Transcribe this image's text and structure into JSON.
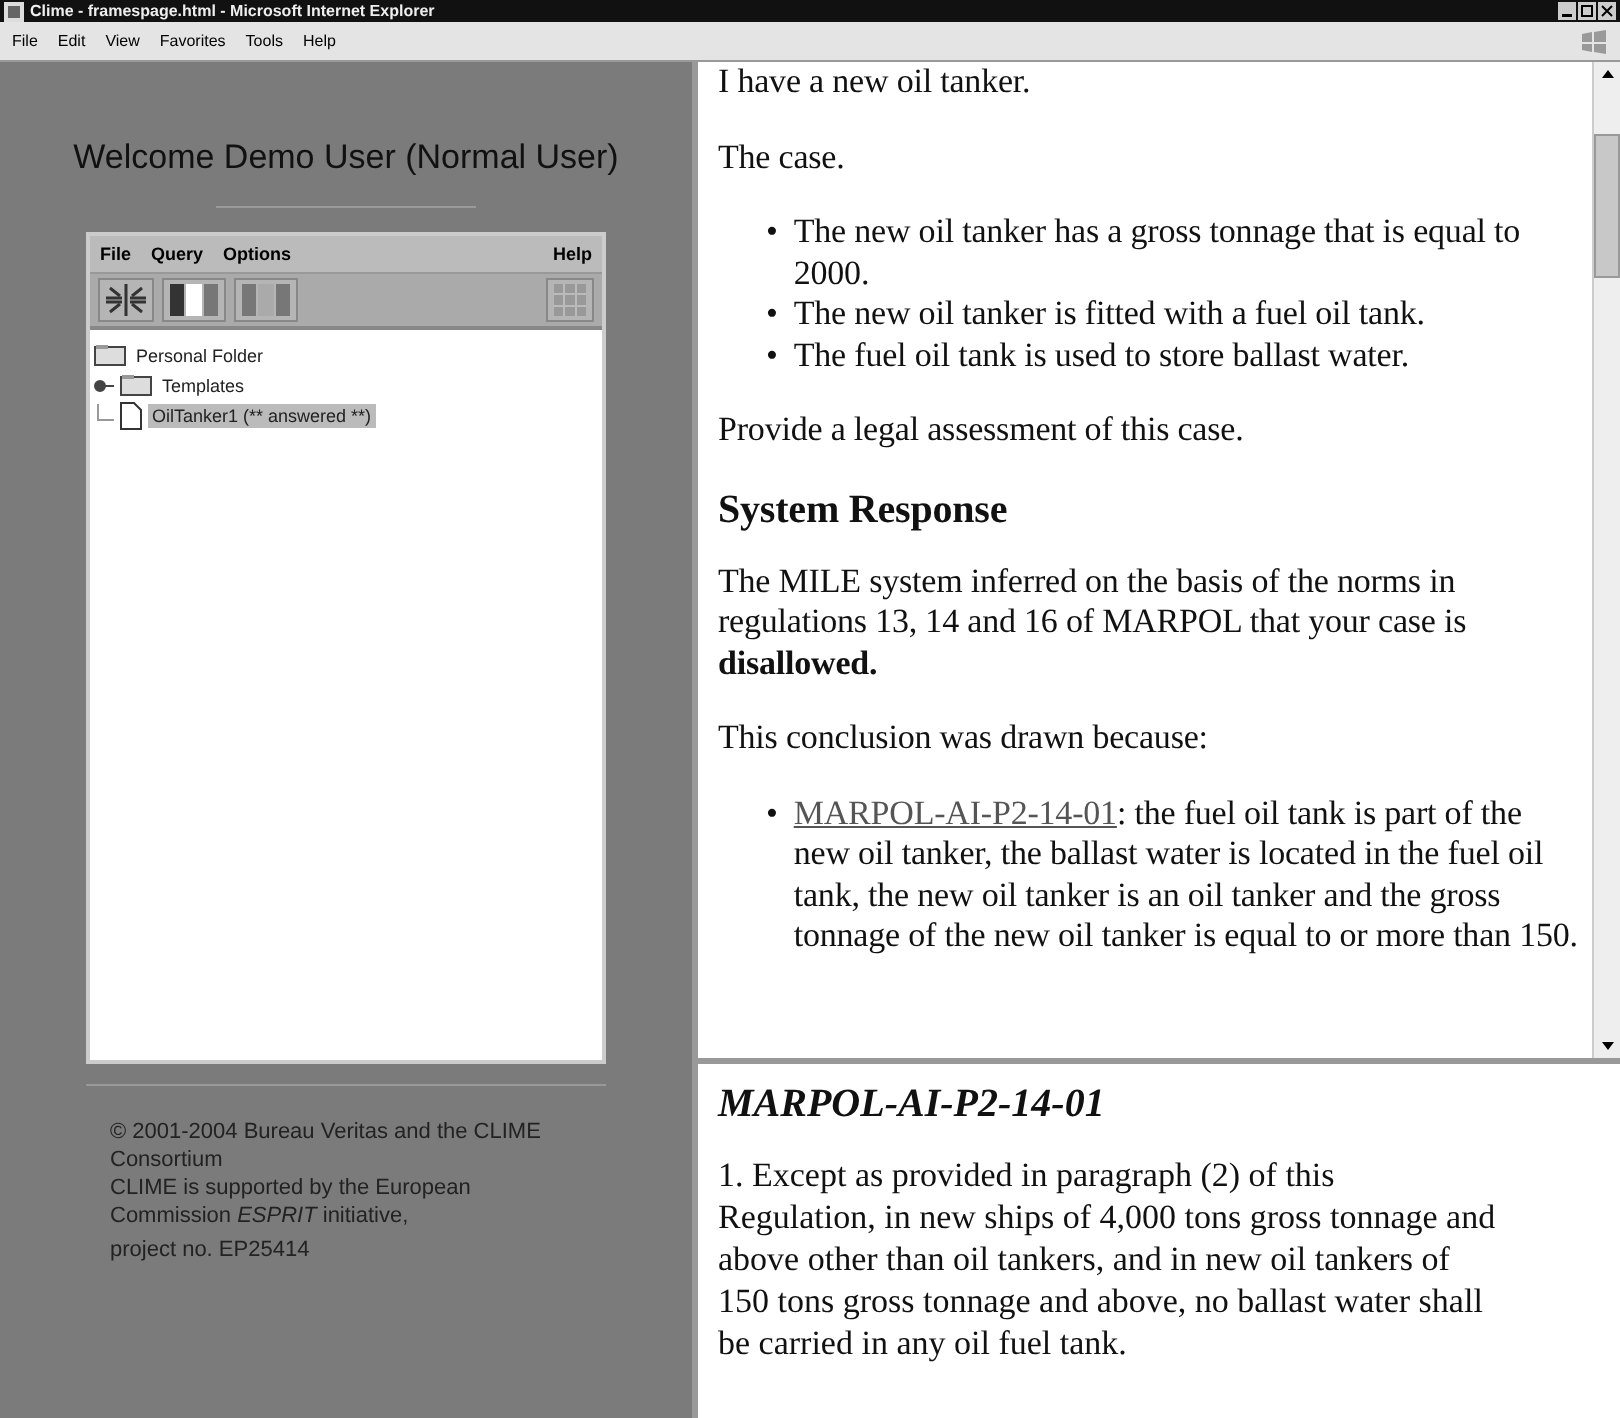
{
  "window": {
    "title": "Clime - framespage.html - Microsoft Internet Explorer"
  },
  "menu_bar": [
    "File",
    "Edit",
    "View",
    "Favorites",
    "Tools",
    "Help"
  ],
  "left_frame": {
    "welcome": "Welcome Demo User (Normal User)",
    "applet": {
      "menus": [
        "File",
        "Query",
        "Options",
        "Help"
      ],
      "tree": [
        {
          "label": "Personal Folder",
          "kind": "folder",
          "selected": false,
          "children": [
            {
              "label": "Templates",
              "kind": "folder",
              "selected": false,
              "expanded": false
            },
            {
              "label": "OilTanker1 (** answered **)",
              "kind": "document",
              "selected": true
            }
          ]
        }
      ]
    },
    "footer": [
      "© 2001-2004 Bureau Veritas and the CLIME Consortium",
      "CLIME is supported by the European Commission *ESPRIT* initiative,",
      "project no. EP25414"
    ]
  },
  "top_frame": {
    "blocks": [
      {
        "kind": "paragraph",
        "text": "I have a new oil tanker."
      },
      {
        "kind": "paragraph",
        "text": "The case."
      },
      {
        "kind": "list",
        "items": [
          {
            "marker": "•",
            "text": "The new oil tanker has a gross tonnage that is equal to 2000."
          },
          {
            "marker": "•",
            "text": "The new oil tanker is fitted with a fuel oil tank."
          },
          {
            "marker": "•",
            "text": "The fuel oil tank is used to store ballast water."
          }
        ]
      },
      {
        "kind": "paragraph",
        "text": "Provide a legal assessment of this case."
      },
      {
        "kind": "heading",
        "text": "System Response"
      },
      {
        "kind": "paragraph",
        "text": "The MILE system inferred on the basis of the norms in regulations 13, 14 and 16 of MARPOL that your case is **disallowed.**"
      },
      {
        "kind": "paragraph",
        "text": "This conclusion was drawn because:"
      },
      {
        "kind": "list",
        "items": [
          {
            "marker": "•",
            "link": "MARPOL-AI-P2-14-01",
            "text": ": the fuel oil tank is part of the new oil tanker, the ballast water is located in the fuel oil tank, the new oil tanker is an oil tanker and the gross tonnage of the new oil tanker is equal to or more than 150."
          }
        ]
      }
    ]
  },
  "bottom_frame": {
    "heading": "MARPOL-AI-P2-14-01",
    "text": "1. Except as provided in paragraph (2) of this Regulation, in new ships of 4,000 tons gross tonnage and above other than oil tankers, and in new oil tankers of 150 tons gross tonnage and above, no ballast water shall be carried in any oil fuel tank."
  }
}
